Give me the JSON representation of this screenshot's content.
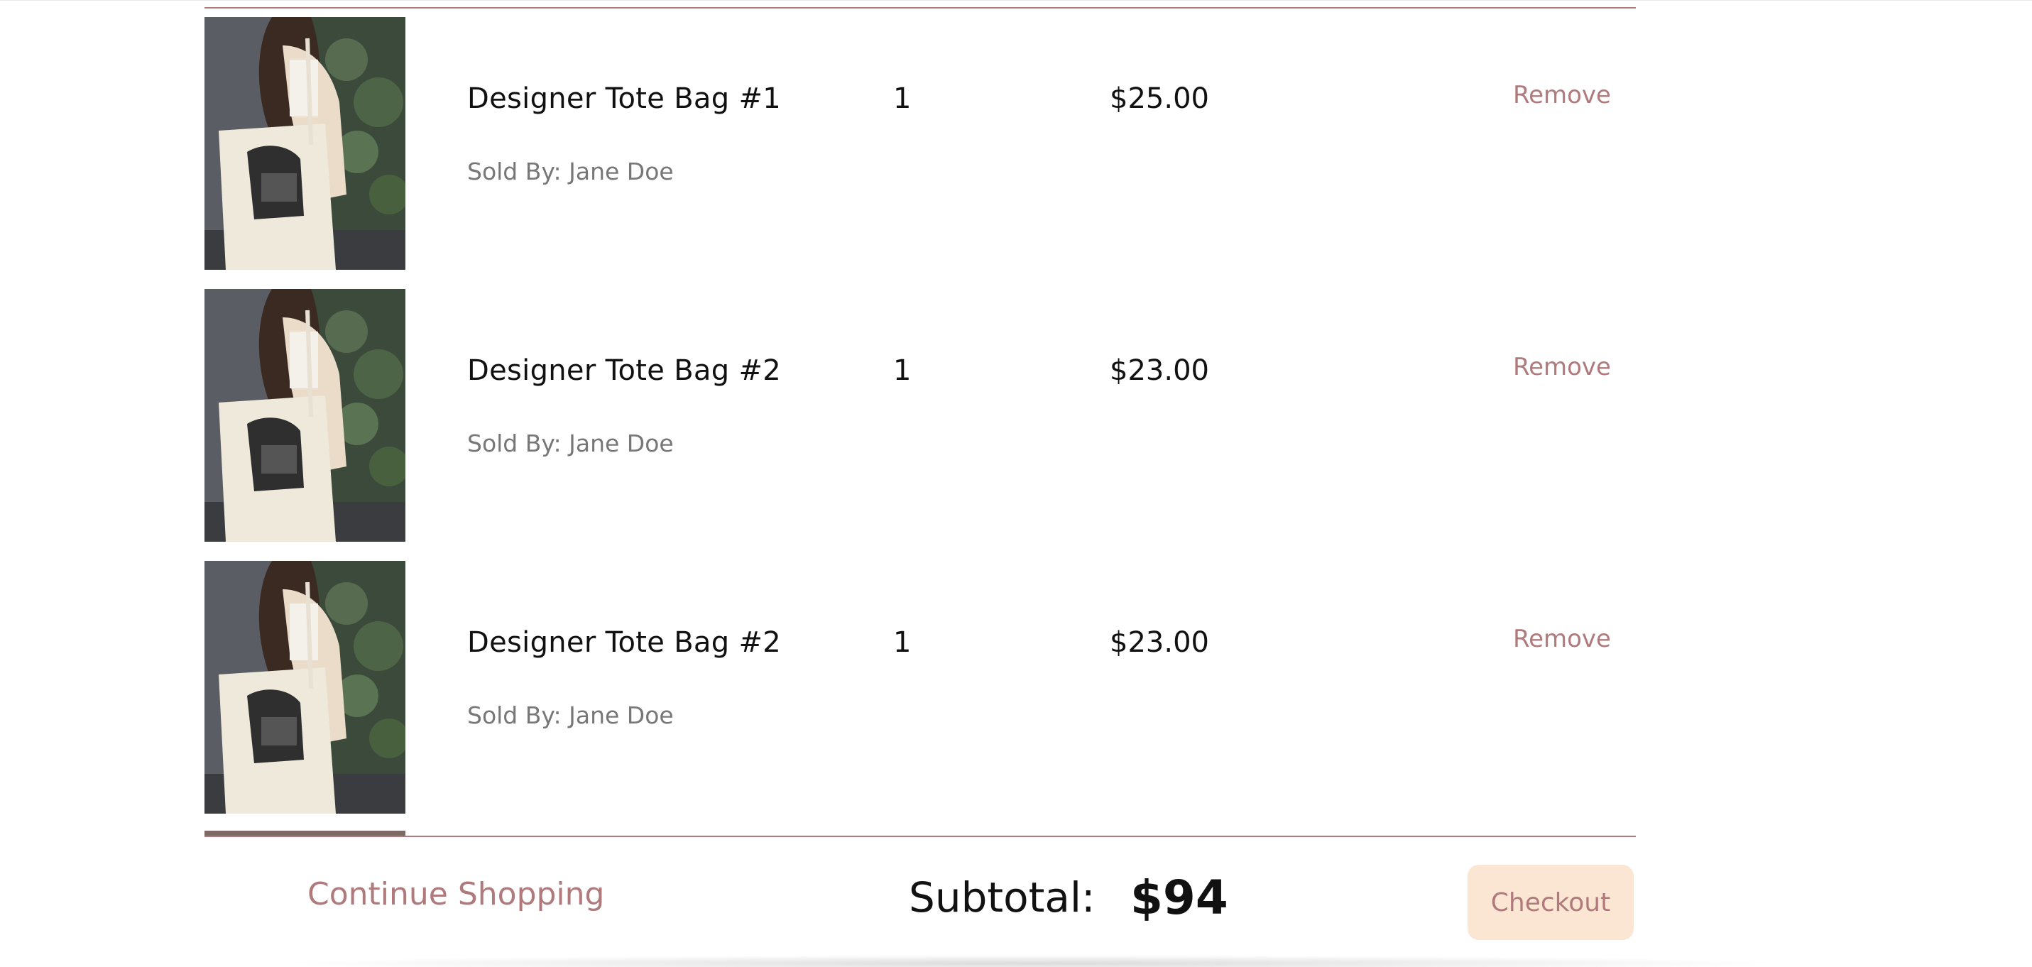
{
  "cart": {
    "items": [
      {
        "name": "Designer Tote Bag #1",
        "seller": "Sold By: Jane Doe",
        "quantity": "1",
        "price": "$25.00",
        "remove_label": "Remove"
      },
      {
        "name": "Designer Tote Bag #2",
        "seller": "Sold By: Jane Doe",
        "quantity": "1",
        "price": "$23.00",
        "remove_label": "Remove"
      },
      {
        "name": "Designer Tote Bag #2",
        "seller": "Sold By: Jane Doe",
        "quantity": "1",
        "price": "$23.00",
        "remove_label": "Remove"
      }
    ]
  },
  "footer": {
    "continue_label": "Continue Shopping",
    "subtotal_label": "Subtotal:",
    "subtotal_value": "$94",
    "checkout_label": "Checkout"
  },
  "colors": {
    "accent": "#b07a7c",
    "checkout_bg": "#fbe5d3",
    "text": "#111111",
    "muted": "#777777"
  }
}
